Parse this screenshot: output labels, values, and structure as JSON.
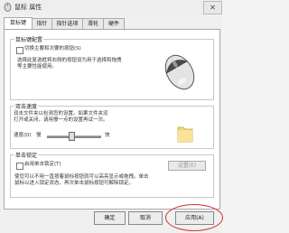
{
  "window": {
    "title": "鼠标 属性",
    "close_symbol": "✕"
  },
  "tabs": [
    {
      "label": "鼠标键",
      "active": true
    },
    {
      "label": "指针",
      "active": false
    },
    {
      "label": "指针选项",
      "active": false
    },
    {
      "label": "滑轮",
      "active": false
    },
    {
      "label": "硬件",
      "active": false
    }
  ],
  "button_config": {
    "title": "鼠标键配置",
    "checkbox_label": "切换主要和次要的按钮(S)",
    "desc_line1": "选择此复选框将右侧的按钮设为用于选择和拖拽",
    "desc_line2": "等主要性能使用。"
  },
  "double_click": {
    "title": "双击速度",
    "desc_line1": "双击文件夹以检测您的设置。如果文件夹没",
    "desc_line2": "打开或关闭，请用慢一点的设置再试一次。",
    "speed_label": "速度(D)",
    "slow": "慢",
    "fast": "快",
    "slider_level": 0.45
  },
  "click_lock": {
    "title": "单击锁定",
    "checkbox_label": "启用单击锁定(T)",
    "settings_button": "设置(E)",
    "desc_line1": "使您可以不用一直按着鼠标按钮就可以高亮显示或拖拽。单击",
    "desc_line2": "鼠标以进入锁定状态，再次单击鼠标按钮可解除锁定。"
  },
  "buttons": {
    "ok": "确定",
    "cancel": "取消",
    "apply": "应用(A)"
  },
  "colors": {
    "annotation_circle": "#d6322b"
  }
}
